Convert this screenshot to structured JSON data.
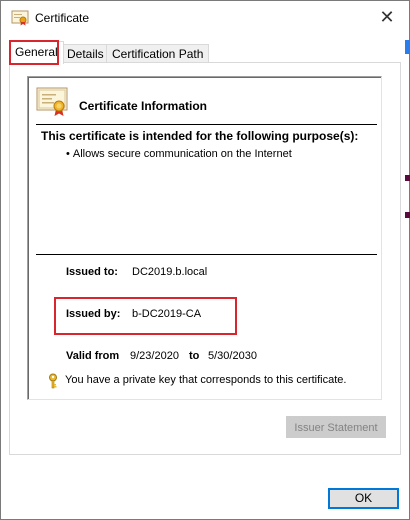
{
  "window": {
    "title": "Certificate",
    "close_glyph": "✕",
    "app_icon": "certificate-icon"
  },
  "tabs": [
    {
      "label": "General",
      "active": true
    },
    {
      "label": "Details",
      "active": false
    },
    {
      "label": "Certification Path",
      "active": false
    }
  ],
  "general": {
    "heading": "Certificate Information",
    "purpose_heading": "This certificate is intended for the following purpose(s):",
    "purposes": [
      "Allows secure communication on the Internet"
    ],
    "issued_to_label": "Issued to:",
    "issued_to_value": "DC2019.b.local",
    "issued_by_label": "Issued by:",
    "issued_by_value": "b-DC2019-CA",
    "valid_from_label": "Valid from",
    "valid_from_value": "9/23/2020",
    "valid_to_label": "to",
    "valid_to_value": "5/30/2030",
    "private_key_note": "You have a private key that corresponds to this certificate.",
    "issuer_statement_button": "Issuer Statement",
    "issuer_statement_enabled": false
  },
  "footer": {
    "ok_button": "OK"
  },
  "colors": {
    "highlight": "#d9252c",
    "focus_border": "#0078d7",
    "disabled_text": "#838383"
  }
}
